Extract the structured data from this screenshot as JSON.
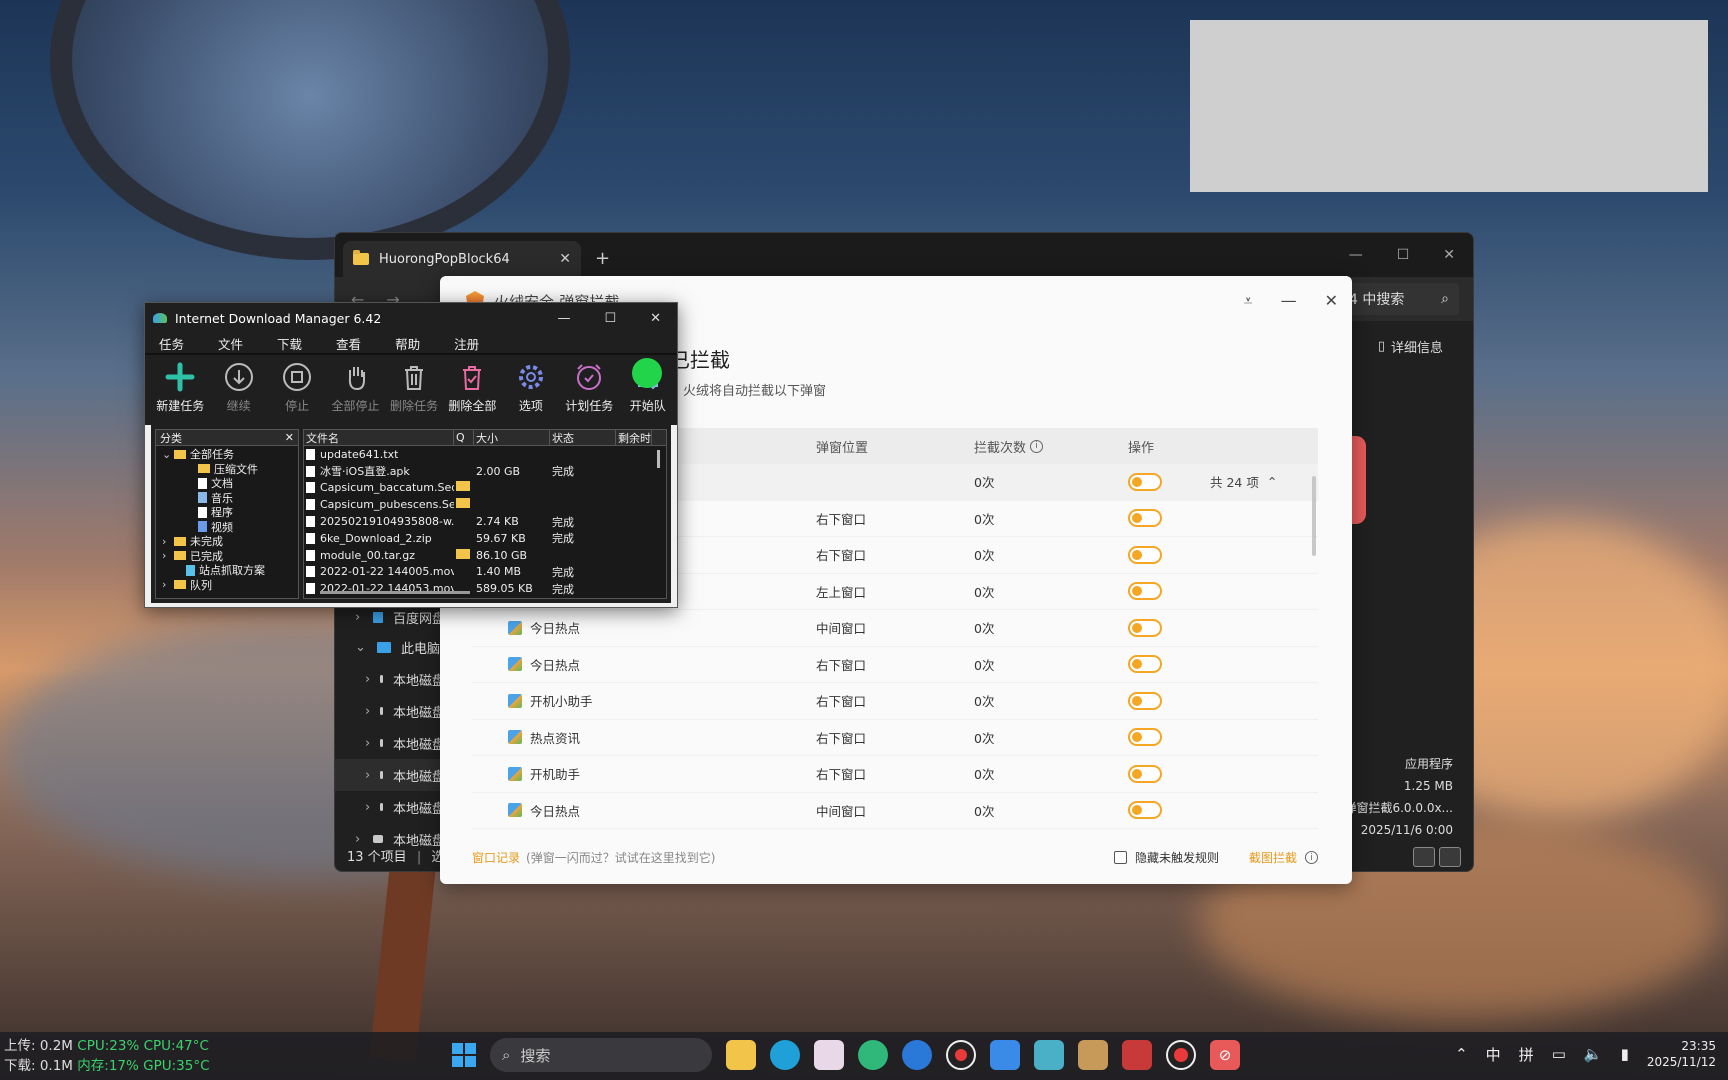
{
  "explorer": {
    "tab_title": "HuorongPopBlock64",
    "tab_close": "✕",
    "new_tab": "+",
    "search_text": "4 中搜索",
    "details_label": "详细信息",
    "sidebar": [
      {
        "label": "百度网盘",
        "icon": "cloud-icon"
      },
      {
        "label": "此电脑",
        "icon": "pc-icon"
      },
      {
        "label": "本地磁盘",
        "icon": "drive-icon"
      },
      {
        "label": "本地磁盘",
        "icon": "drive-icon"
      },
      {
        "label": "本地磁盘",
        "icon": "drive-icon"
      },
      {
        "label": "本地磁盘",
        "icon": "drive-icon"
      },
      {
        "label": "本地磁盘",
        "icon": "drive-icon"
      },
      {
        "label": "本地磁盘",
        "icon": "drive-icon"
      }
    ],
    "status_count": "13 个项目",
    "status_sel": "选",
    "info_type": "应用程序",
    "info_size": "1.25 MB",
    "info_desc": "弹窗拦截6.0.0.0x...",
    "info_date": "2025/11/6 0:00"
  },
  "huorong": {
    "app_title": "火绒安全-弹窗拦截",
    "heading": "已拦截",
    "subtitle": "火绒将自动拦截以下弹窗",
    "columns": {
      "pos": "弹窗位置",
      "count": "拦截次数",
      "op": "操作"
    },
    "group": {
      "count": "0次",
      "total": "共 24 项"
    },
    "rows": [
      {
        "name": "",
        "pos": "右下窗口",
        "count": "0次"
      },
      {
        "name": "",
        "pos": "右下窗口",
        "count": "0次"
      },
      {
        "name": "",
        "pos": "左上窗口",
        "count": "0次"
      },
      {
        "name": "今日热点",
        "pos": "中间窗口",
        "count": "0次"
      },
      {
        "name": "今日热点",
        "pos": "右下窗口",
        "count": "0次"
      },
      {
        "name": "开机小助手",
        "pos": "右下窗口",
        "count": "0次"
      },
      {
        "name": "热点资讯",
        "pos": "右下窗口",
        "count": "0次"
      },
      {
        "name": "开机助手",
        "pos": "右下窗口",
        "count": "0次"
      },
      {
        "name": "今日热点",
        "pos": "中间窗口",
        "count": "0次"
      }
    ],
    "footer": {
      "log_link": "窗口记录",
      "hint": "(弹窗一闪而过？试试在这里找到它)",
      "hide_label": "隐藏未触发规则",
      "capture_link": "截图拦截"
    },
    "accent": "#f5a623"
  },
  "idm": {
    "title": "Internet Download Manager 6.42",
    "menu": [
      "任务",
      "文件",
      "下载",
      "查看",
      "帮助",
      "注册"
    ],
    "toolbar": [
      {
        "label": "新建任务",
        "icon": "plus-icon",
        "enabled": true
      },
      {
        "label": "继续",
        "icon": "download-circle-icon",
        "enabled": false
      },
      {
        "label": "停止",
        "icon": "stop-icon",
        "enabled": false
      },
      {
        "label": "全部停止",
        "icon": "hand-icon",
        "enabled": false
      },
      {
        "label": "删除任务",
        "icon": "trash-icon",
        "enabled": false
      },
      {
        "label": "删除全部",
        "icon": "trash-check-icon",
        "enabled": true
      },
      {
        "label": "选项",
        "icon": "gear-icon",
        "enabled": true
      },
      {
        "label": "计划任务",
        "icon": "alarm-clock-icon",
        "enabled": true
      },
      {
        "label": "开始队",
        "icon": "queue-icon",
        "enabled": true
      }
    ],
    "tree_header": "分类",
    "tree_close": "✕",
    "tree": [
      {
        "label": "全部任务",
        "indent": 0,
        "type": "folder",
        "exp": "⌄"
      },
      {
        "label": "压缩文件",
        "indent": 2,
        "type": "folder",
        "exp": ""
      },
      {
        "label": "文档",
        "indent": 2,
        "type": "doc",
        "exp": ""
      },
      {
        "label": "音乐",
        "indent": 2,
        "type": "music",
        "exp": ""
      },
      {
        "label": "程序",
        "indent": 2,
        "type": "doc",
        "exp": ""
      },
      {
        "label": "视频",
        "indent": 2,
        "type": "video",
        "exp": ""
      },
      {
        "label": "未完成",
        "indent": 0,
        "type": "folder",
        "exp": "›"
      },
      {
        "label": "已完成",
        "indent": 0,
        "type": "folder",
        "exp": "›"
      },
      {
        "label": "站点抓取方案",
        "indent": 1,
        "type": "site",
        "exp": ""
      },
      {
        "label": "队列",
        "indent": 0,
        "type": "folder",
        "exp": "›"
      }
    ],
    "list_columns": [
      "文件名",
      "Q",
      "大小",
      "状态",
      "剩余时"
    ],
    "files": [
      {
        "name": "update641.txt",
        "q": false,
        "size": "",
        "status": ""
      },
      {
        "name": "冰雪·iOS直登.apk",
        "q": false,
        "size": "2.00  GB",
        "status": "完成"
      },
      {
        "name": "Capsicum_baccatum.Seq...",
        "q": true,
        "size": "",
        "status": ""
      },
      {
        "name": "Capsicum_pubescens.Se...",
        "q": true,
        "size": "",
        "status": ""
      },
      {
        "name": "20250219104935808-w...",
        "q": false,
        "size": "2.74  KB",
        "status": "完成"
      },
      {
        "name": "6ke_Download_2.zip",
        "q": false,
        "size": "59.67  KB",
        "status": "完成"
      },
      {
        "name": "module_00.tar.gz",
        "q": true,
        "size": "86.10  GB",
        "status": ""
      },
      {
        "name": "2022-01-22 144005.mov",
        "q": false,
        "size": "1.40  MB",
        "status": "完成"
      },
      {
        "name": "2022-01-22 144053.mov",
        "q": false,
        "size": "589.05  KB",
        "status": "完成"
      }
    ]
  },
  "taskbar": {
    "upload": "上传:  0.2M",
    "download": "下载:  0.1M",
    "cpu": "CPU:23%",
    "cpu_temp": "CPU:47°C",
    "mem": "内存:17%",
    "gpu_temp": "GPU:35°C",
    "search_placeholder": "搜索",
    "apps": [
      "file-explorer-icon",
      "edge-icon",
      "anime-app-icon",
      "green-app-icon",
      "blue-app-icon",
      "record-icon",
      "feishu-icon",
      "screen-icon",
      "package-icon",
      "voicemeeter-icon",
      "record2-icon",
      "popblock-icon"
    ],
    "ime1": "中",
    "ime2": "拼",
    "time": "23:35",
    "date": "2025/11/12"
  }
}
